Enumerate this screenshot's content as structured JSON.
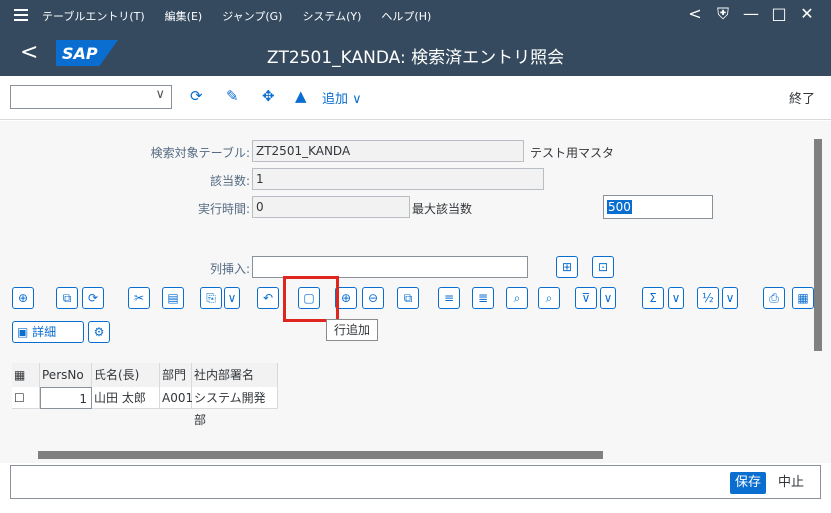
{
  "menu": {
    "items": [
      "テーブルエントリ(T)",
      "編集(E)",
      "ジャンプ(G)",
      "システム(Y)",
      "ヘルプ(H)"
    ],
    "window_controls": [
      "<",
      "⛨",
      "—",
      "□",
      "✕"
    ]
  },
  "header": {
    "back": "<",
    "logo": "SAP",
    "title": "ZT2501_KANDA: 検索済エントリ照会"
  },
  "toolbar": {
    "add_label": "追加",
    "add_chevron": "∨",
    "end_label": "終了",
    "command_dropdown": "∨"
  },
  "form": {
    "table_label": "検索対象テーブル:",
    "table_value": "ZT2501_KANDA",
    "table_desc": "テスト用マスタ",
    "hits_label": "該当数:",
    "hits_value": "1",
    "runtime_label": "実行時間:",
    "runtime_value": "0",
    "max_hits_label": "最大該当数",
    "max_hits_value": "500",
    "insert_label": "列挿入:"
  },
  "tooltip": "行追加",
  "detail_label": "詳細",
  "table": {
    "headers": [
      "PersNo",
      "氏名(長)",
      "部門",
      "社内部署名"
    ],
    "rows": [
      {
        "persno": "1",
        "name": "山田 太郎",
        "dept": "A001",
        "deptname": "システム開発部"
      }
    ]
  },
  "status": {
    "save_label": "保存",
    "cancel_label": "中止"
  }
}
